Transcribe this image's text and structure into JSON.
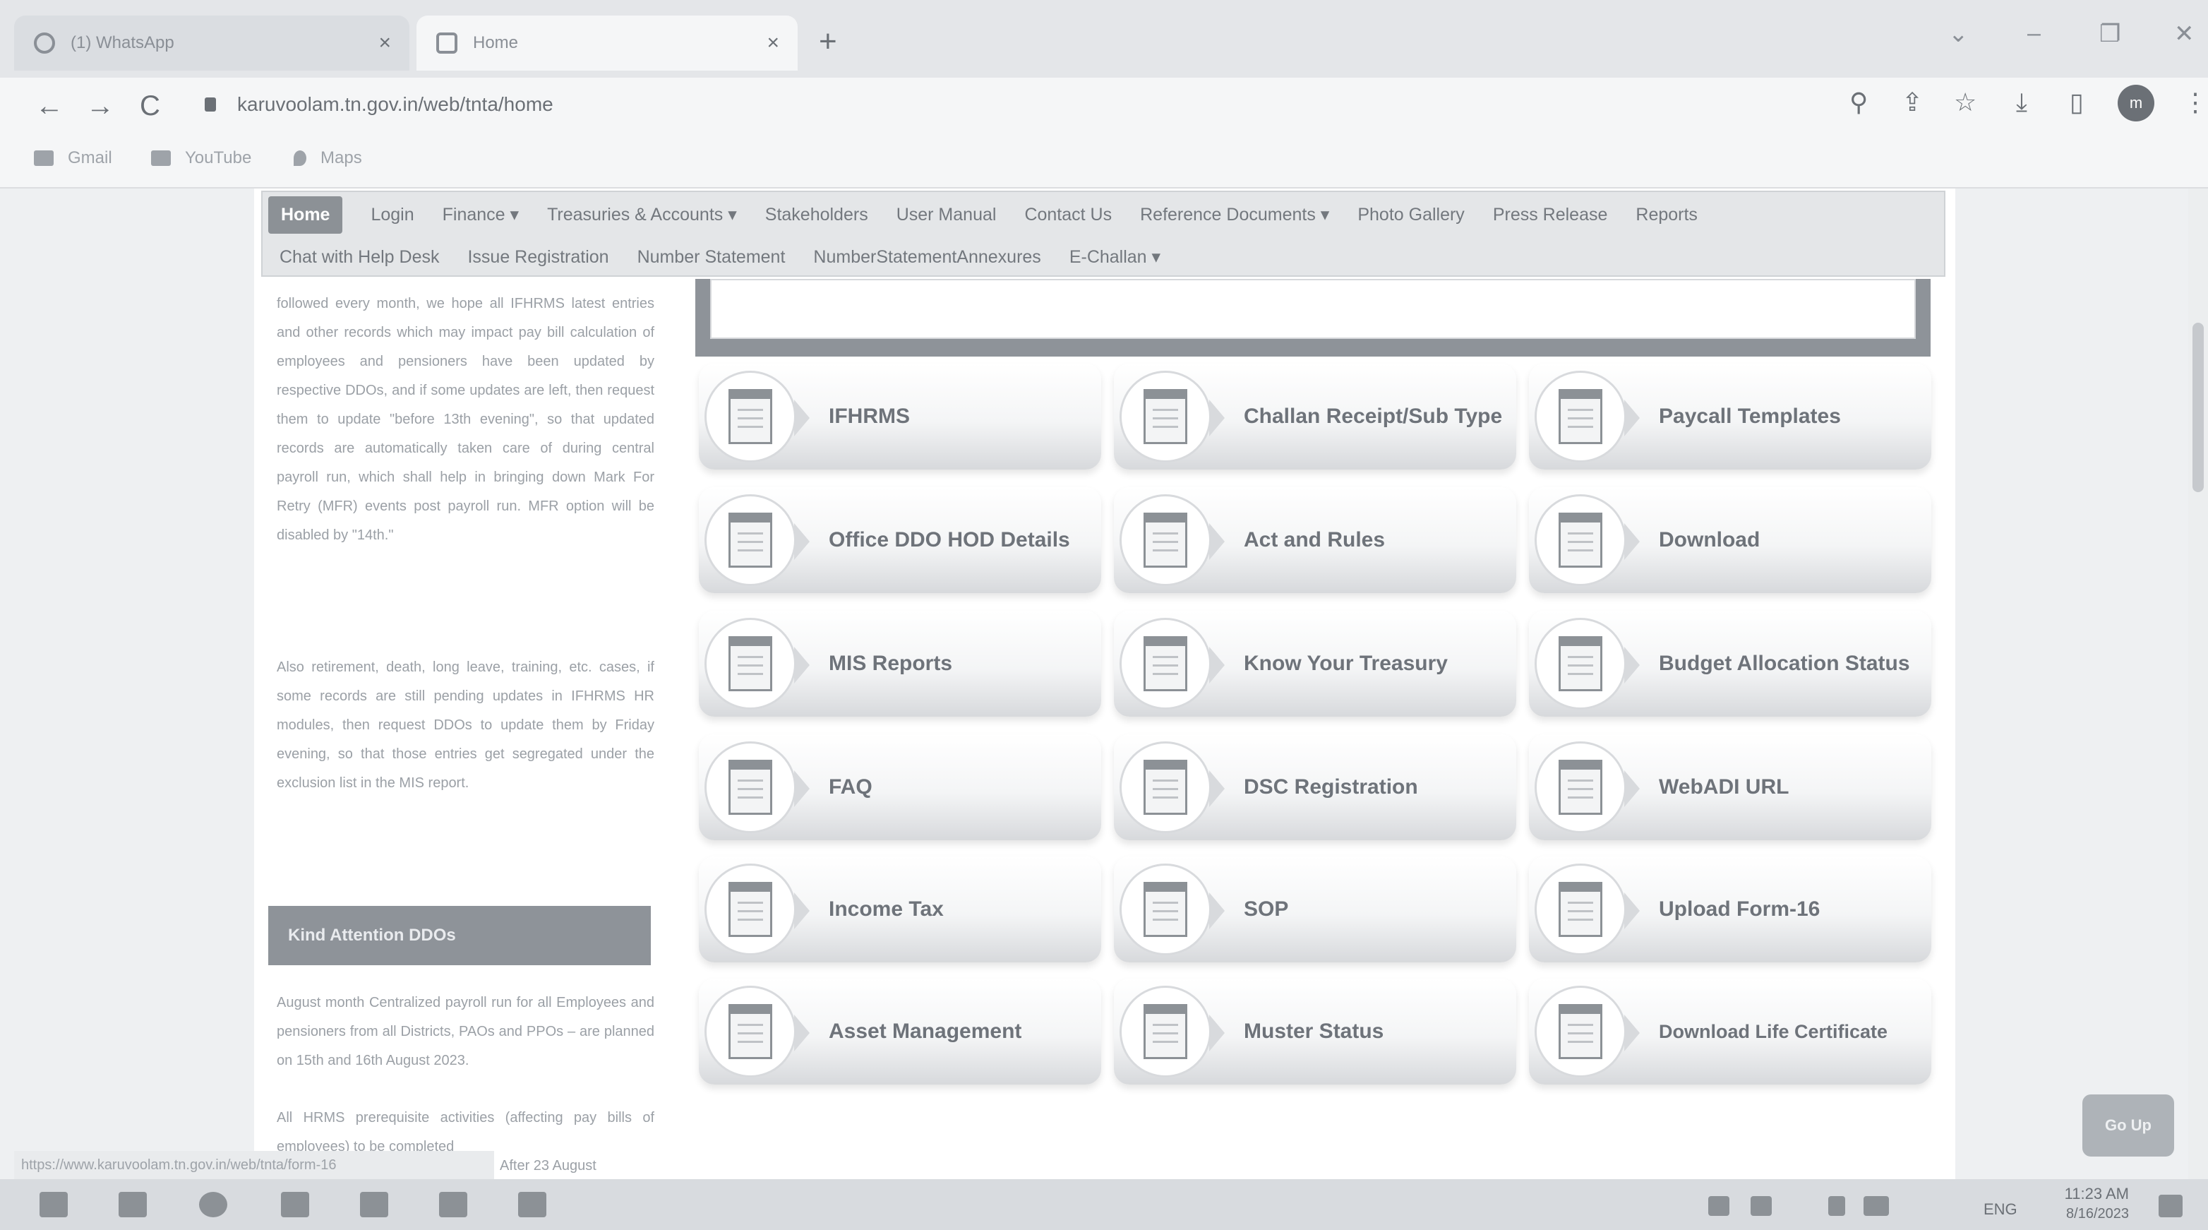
{
  "browser": {
    "tabs": [
      {
        "label": "(1) WhatsApp",
        "close": "×"
      },
      {
        "label": "Home",
        "close": "×"
      }
    ],
    "new_tab": "+",
    "window_controls": {
      "dropdown": "⌄",
      "minimize": "–",
      "restore": "❐",
      "close": "✕"
    },
    "nav": {
      "back": "←",
      "forward": "→",
      "reload": "C"
    },
    "url": "karuvoolam.tn.gov.in/web/tnta/home",
    "tool_icons": {
      "search": "⚲",
      "share": "⇪",
      "star": "☆",
      "download": "⤓",
      "sidebar": "▯",
      "menu": "⋮"
    },
    "profile_initial": "m",
    "bookmarks": [
      {
        "label": "Gmail",
        "icon": "gmail-icon"
      },
      {
        "label": "YouTube",
        "icon": "youtube-icon"
      },
      {
        "label": "Maps",
        "icon": "maps-icon"
      }
    ]
  },
  "menu": {
    "row1": [
      "Home",
      "Login",
      "Finance ▾",
      "Treasuries & Accounts ▾",
      "Stakeholders",
      "User Manual",
      "Contact Us",
      "Reference Documents ▾",
      "Photo Gallery",
      "Press Release",
      "Reports"
    ],
    "row2": [
      "Chat with Help Desk",
      "Issue Registration",
      "Number Statement",
      "NumberStatementAnnexures",
      "E-Challan ▾"
    ]
  },
  "sidebar": {
    "para1": "followed every month, we hope all IFHRMS latest entries and other records which may impact pay bill calculation of employees and pensioners have been updated by respective DDOs, and if some updates are left, then request them to update \"before 13th evening\", so that updated records are automatically taken care of during central payroll run, which shall help in bringing down Mark For Retry (MFR) events post payroll run. MFR option will be disabled by \"14th.\"",
    "para2": "Also retirement, death, long leave, training, etc. cases, if some records are still pending updates in IFHRMS HR modules, then request DDOs to update them by Friday evening, so that those entries get segregated under the exclusion list in the MIS report.",
    "attention_title": "Kind Attention DDOs",
    "para3": "August month Centralized payroll run for all Employees and pensioners from all Districts, PAOs and PPOs – are planned on 15th and 16th August 2023.",
    "para4": "All HRMS prerequisite activities (affecting pay bills of employees) to be completed",
    "para5": "After 23 August"
  },
  "tiles": [
    "IFHRMS",
    "Challan Receipt/Sub Type",
    "Paycall Templates",
    "Office DDO HOD Details",
    "Act and Rules",
    "Download",
    "MIS Reports",
    "Know Your Treasury",
    "Budget Allocation Status",
    "FAQ",
    "DSC Registration",
    "WebADI URL",
    "Income Tax",
    "SOP",
    "Upload Form-16",
    "Asset Management",
    "Muster Status",
    "Download Life Certificate"
  ],
  "go_up": "Go Up",
  "status_url": "https://www.karuvoolam.tn.gov.in/web/tnta/form-16",
  "taskbar": {
    "lang": "ENG",
    "time": "11:23 AM",
    "date": "8/16/2023"
  }
}
